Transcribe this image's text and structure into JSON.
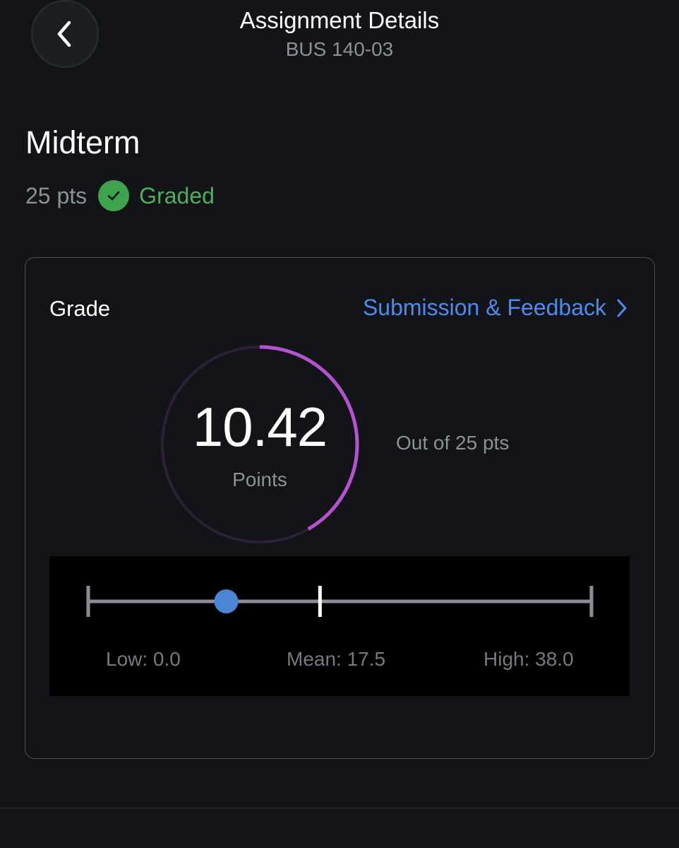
{
  "header": {
    "title": "Assignment Details",
    "subtitle": "BUS 140-03"
  },
  "assignment": {
    "title": "Midterm",
    "points": "25 pts",
    "status": "Graded",
    "status_icon": "check-circle-icon",
    "status_color": "#3fa24f"
  },
  "grade": {
    "label": "Grade",
    "feedback_link": "Submission & Feedback",
    "score": "10.42",
    "score_value": 10.42,
    "max_value": 25,
    "score_unit": "Points",
    "out_of": "Out of 25 pts",
    "ring_color": "#b453d2",
    "ring_track_color": "#2d1f36"
  },
  "stats": {
    "low_label": "Low: 0.0",
    "mean_label": "Mean: 17.5",
    "high_label": "High: 38.0",
    "low": 0.0,
    "mean": 17.5,
    "high": 38.0,
    "score": 10.42,
    "marker_color": "#4a86d4"
  },
  "colors": {
    "background": "#121417",
    "accent_blue": "#4a8cf0",
    "success_green": "#4cb05a"
  }
}
